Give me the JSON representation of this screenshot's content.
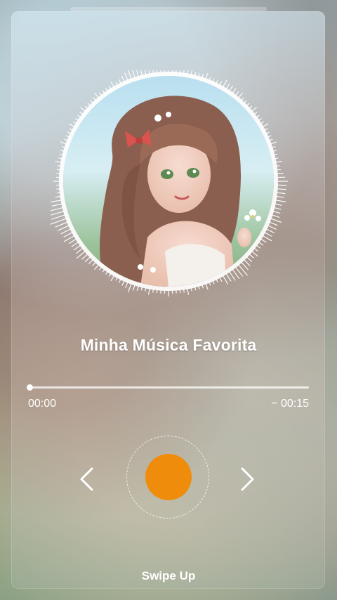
{
  "player": {
    "song_title": "Minha Música Favorita",
    "elapsed_time": "00:00",
    "remaining_time": "− 00:15",
    "progress": 0.0,
    "swipe_hint": "Swipe Up"
  },
  "colors": {
    "accent": "#f08c0c",
    "text": "#ffffff"
  },
  "icons": {
    "previous": "chevron-left-icon",
    "next": "chevron-right-icon",
    "play": "play-dot"
  }
}
